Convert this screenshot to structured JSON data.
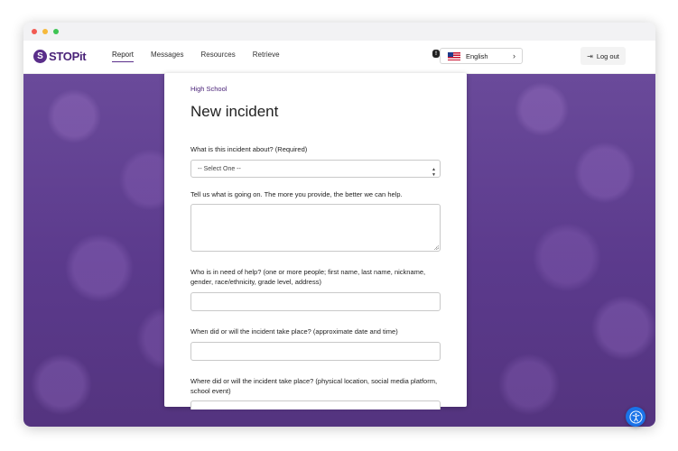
{
  "brand": {
    "name": "STOPit",
    "mark": "S"
  },
  "nav": {
    "items": [
      {
        "label": "Report",
        "active": true
      },
      {
        "label": "Messages",
        "active": false
      },
      {
        "label": "Resources",
        "active": false
      },
      {
        "label": "Retrieve",
        "active": false
      }
    ]
  },
  "language": {
    "selected": "English",
    "flag_icon": "us-flag-icon",
    "chevron_icon": "chevron-right-icon"
  },
  "logout": {
    "label": "Log out",
    "icon": "logout-icon"
  },
  "form": {
    "breadcrumb": "High School",
    "title": "New incident",
    "about": {
      "label": "What is this incident about? (Required)",
      "value": "-- Select One --"
    },
    "description": {
      "label": "Tell us what is going on. The more you provide, the better we can help.",
      "value": ""
    },
    "who": {
      "label": "Who is in need of help? (one or more people; first name, last name, nickname, gender, race/ethnicity, grade level, address)",
      "value": ""
    },
    "when": {
      "label": "When did or will the incident take place? (approximate date and time)",
      "value": ""
    },
    "where": {
      "label": "Where did or will the incident take place? (physical location, social media platform, school event)",
      "value": ""
    }
  },
  "colors": {
    "brand_purple": "#5a2e8a",
    "accessibility_blue": "#1a73e8"
  },
  "accessibility": {
    "icon": "accessibility-icon"
  }
}
